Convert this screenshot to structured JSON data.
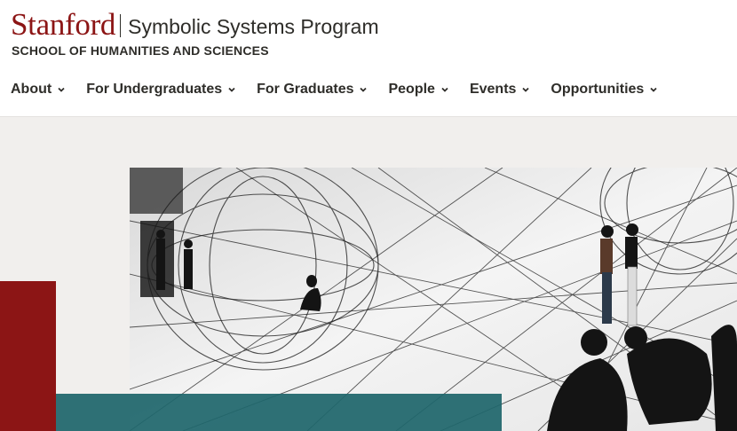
{
  "brand": {
    "wordmark": "Stanford",
    "program": "Symbolic Systems Program",
    "school": "SCHOOL OF HUMANITIES AND SCIENCES"
  },
  "nav": {
    "items": [
      {
        "label": "About",
        "icon": "chevron-down-icon"
      },
      {
        "label": "For Undergraduates",
        "icon": "chevron-down-icon"
      },
      {
        "label": "For Graduates",
        "icon": "chevron-down-icon"
      },
      {
        "label": "People",
        "icon": "chevron-down-icon"
      },
      {
        "label": "Events",
        "icon": "chevron-down-icon"
      },
      {
        "label": "Opportunities",
        "icon": "chevron-down-icon"
      }
    ]
  },
  "colors": {
    "cardinal": "#8c1515",
    "teal": "#1f666c",
    "hero_bg": "#f1efed",
    "text": "#2e2d29"
  }
}
